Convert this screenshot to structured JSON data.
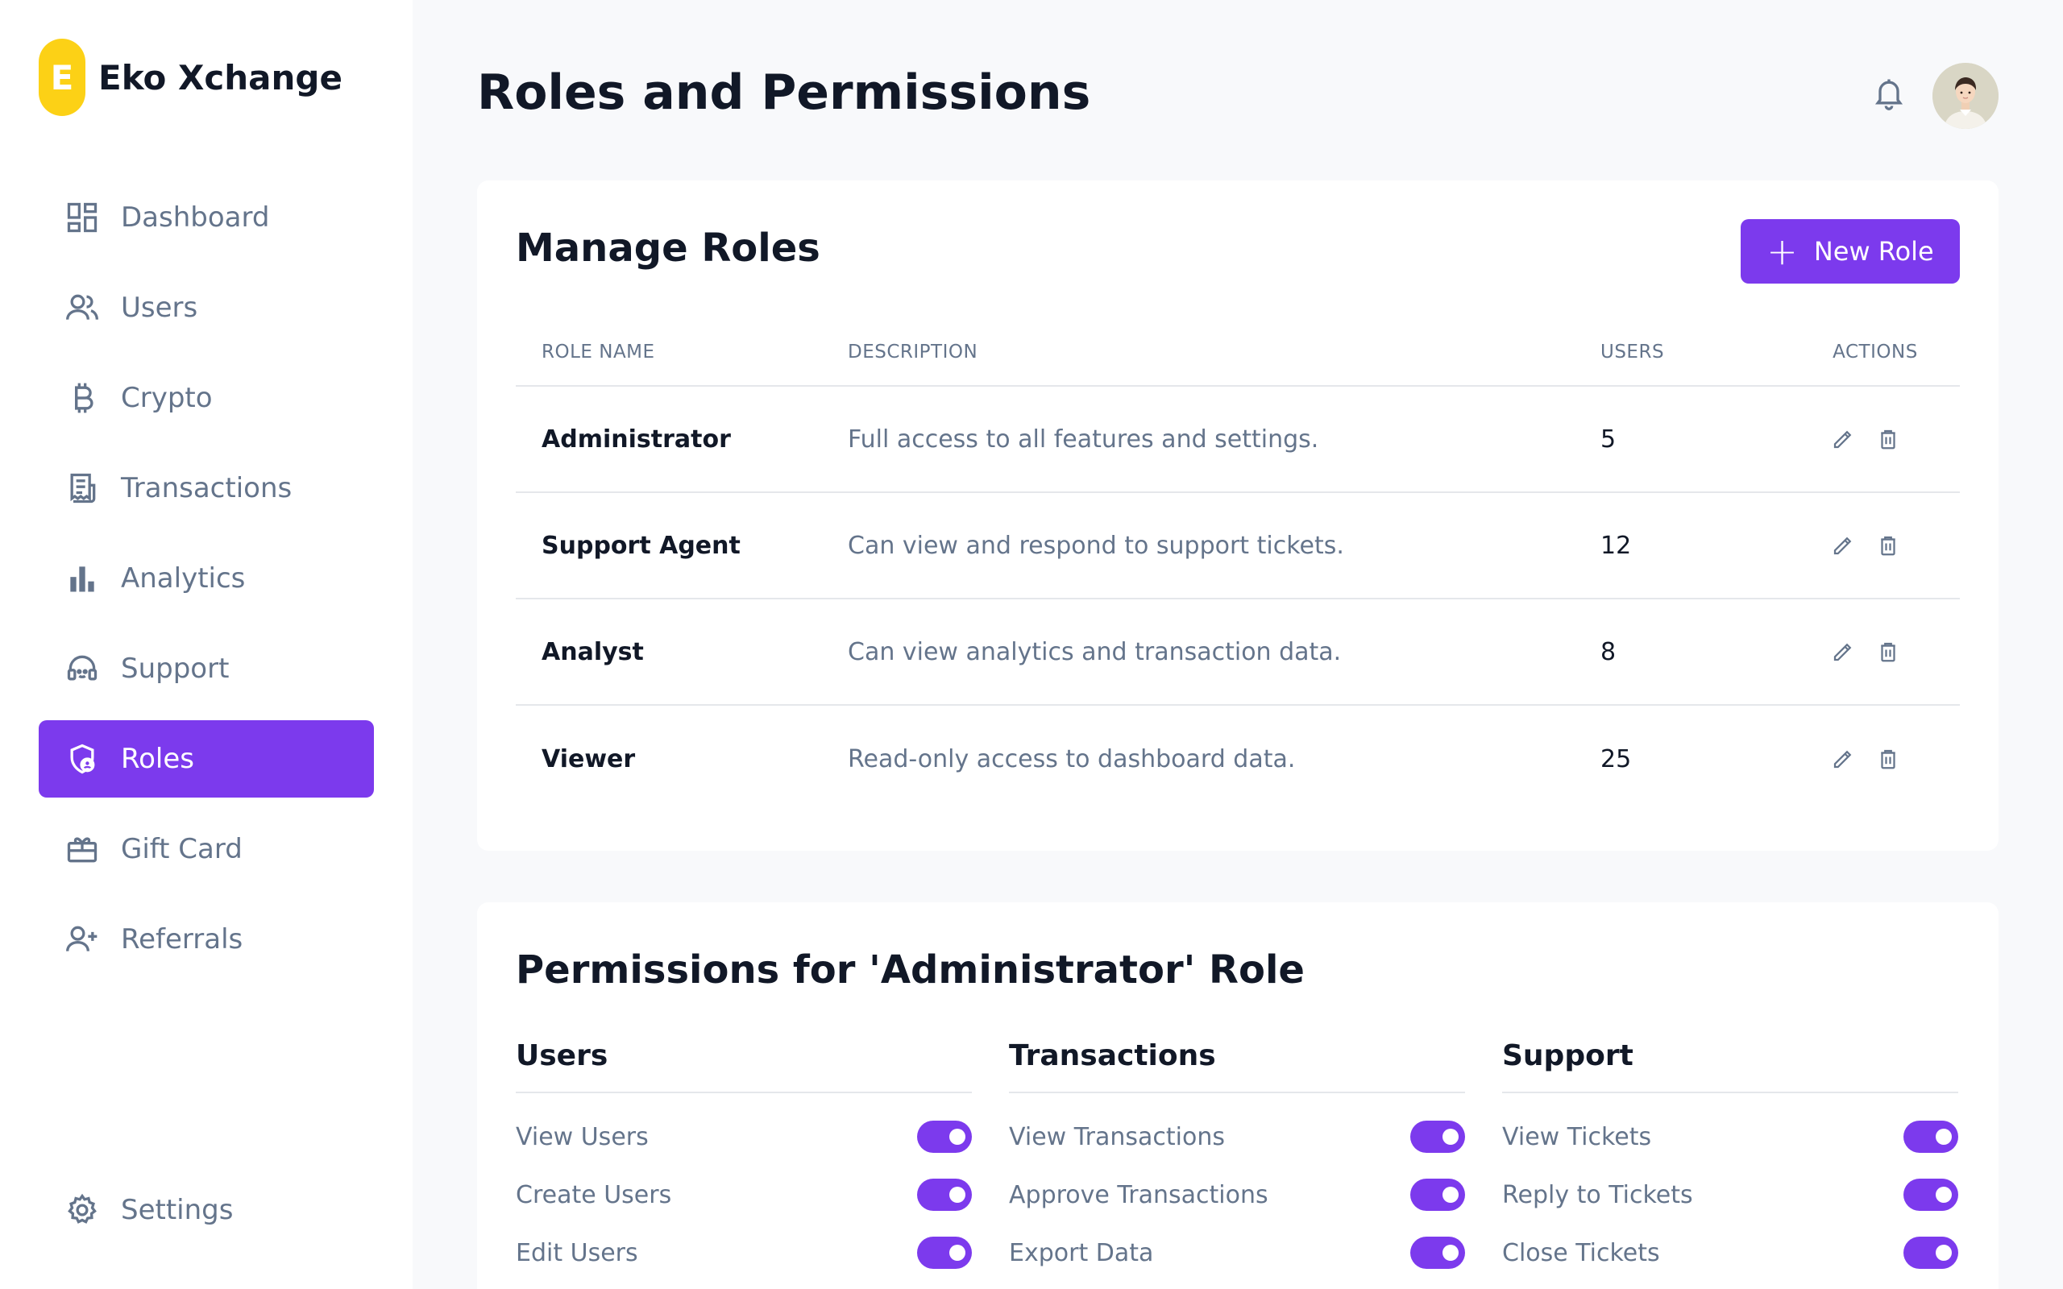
{
  "brand": {
    "logo_letter": "E",
    "name": "Eko Xchange"
  },
  "sidebar": {
    "items": [
      {
        "label": "Dashboard",
        "icon": "dashboard-icon",
        "active": false
      },
      {
        "label": "Users",
        "icon": "users-icon",
        "active": false
      },
      {
        "label": "Crypto",
        "icon": "bitcoin-icon",
        "active": false
      },
      {
        "label": "Transactions",
        "icon": "receipt-icon",
        "active": false
      },
      {
        "label": "Analytics",
        "icon": "bar-chart-icon",
        "active": false
      },
      {
        "label": "Support",
        "icon": "headset-icon",
        "active": false
      },
      {
        "label": "Roles",
        "icon": "shield-user-icon",
        "active": true
      },
      {
        "label": "Gift Card",
        "icon": "gift-card-icon",
        "active": false
      },
      {
        "label": "Referrals",
        "icon": "user-plus-icon",
        "active": false
      }
    ],
    "settings": {
      "label": "Settings",
      "icon": "gear-icon"
    }
  },
  "header": {
    "title": "Roles and Permissions",
    "bell_icon": "bell-icon",
    "avatar_icon": "avatar"
  },
  "roles_card": {
    "title": "Manage Roles",
    "new_role_label": "New Role",
    "columns": [
      "ROLE NAME",
      "DESCRIPTION",
      "USERS",
      "ACTIONS"
    ],
    "rows": [
      {
        "name": "Administrator",
        "description": "Full access to all features and settings.",
        "users": "5"
      },
      {
        "name": "Support Agent",
        "description": "Can view and respond to support tickets.",
        "users": "12"
      },
      {
        "name": "Analyst",
        "description": "Can view analytics and transaction data.",
        "users": "8"
      },
      {
        "name": "Viewer",
        "description": "Read-only access to dashboard data.",
        "users": "25"
      }
    ]
  },
  "permissions_card": {
    "title": "Permissions for 'Administrator' Role",
    "groups": [
      {
        "title": "Users",
        "items": [
          {
            "label": "View Users",
            "enabled": true
          },
          {
            "label": "Create Users",
            "enabled": true
          },
          {
            "label": "Edit Users",
            "enabled": true
          }
        ]
      },
      {
        "title": "Transactions",
        "items": [
          {
            "label": "View Transactions",
            "enabled": true
          },
          {
            "label": "Approve Transactions",
            "enabled": true
          },
          {
            "label": "Export Data",
            "enabled": true
          }
        ]
      },
      {
        "title": "Support",
        "items": [
          {
            "label": "View Tickets",
            "enabled": true
          },
          {
            "label": "Reply to Tickets",
            "enabled": true
          },
          {
            "label": "Close Tickets",
            "enabled": true
          }
        ]
      }
    ]
  },
  "colors": {
    "accent": "#7c3aed",
    "brand_yellow": "#fcd116",
    "muted_text": "#64748b"
  }
}
